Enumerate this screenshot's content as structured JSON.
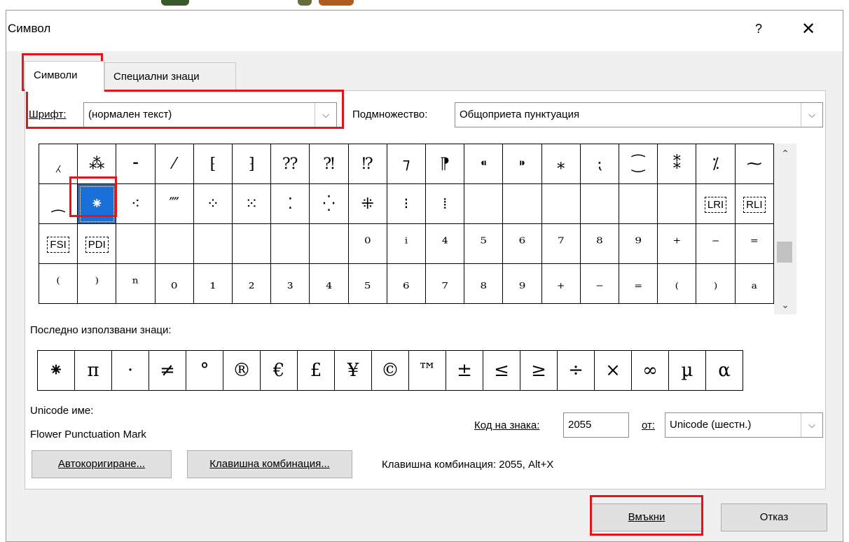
{
  "dialog": {
    "title": "Символ",
    "help_glyph": "?",
    "close_glyph": "✕"
  },
  "tabs": [
    {
      "label": "Символи"
    },
    {
      "label": "Специални знаци"
    }
  ],
  "font": {
    "label": "Шрифт:",
    "value": "(нормален текст)"
  },
  "subset": {
    "label": "Подмножество:",
    "value": "Общоприета пунктуация"
  },
  "symbol_grid": {
    "rows": [
      [
        "⁁",
        "⁂",
        "⁃",
        "⁄",
        "⁅",
        "⁆",
        "⁇",
        "⁈",
        "⁉",
        "⁊",
        "⁋",
        "⁌",
        "⁍",
        "⁎",
        "⁏",
        "⁐",
        "⁑",
        "⁒",
        "⁓"
      ],
      [
        "⁔",
        "⁕",
        "⁖",
        "⁗",
        "⁘",
        "⁙",
        "⁚",
        "⁛",
        "⁜",
        "⁝",
        "⁞",
        "",
        "",
        "",
        "",
        "",
        "",
        "LRI",
        "RLI"
      ],
      [
        "FSI",
        "PDI",
        "",
        "",
        "",
        "",
        "",
        "",
        "⁰",
        "ⁱ",
        "⁴",
        "⁵",
        "⁶",
        "⁷",
        "⁸",
        "⁹",
        "⁺",
        "⁻",
        "⁼"
      ],
      [
        "⁽",
        "⁾",
        "ⁿ",
        "₀",
        "₁",
        "₂",
        "₃",
        "₄",
        "₅",
        "₆",
        "₇",
        "₈",
        "₉",
        "₊",
        "₋",
        "₌",
        "₍",
        "₎",
        "ₐ"
      ]
    ],
    "selected": "⁕"
  },
  "scroll": {
    "up": "⌃",
    "down": "⌄"
  },
  "recent": {
    "label": "Последно използвани знаци:",
    "symbols": [
      "⁕",
      "π",
      "·",
      "≠",
      "°",
      "®",
      "€",
      "£",
      "¥",
      "©",
      "™",
      "±",
      "≤",
      "≥",
      "÷",
      "×",
      "∞",
      "µ",
      "α"
    ]
  },
  "unicode_name": {
    "label": "Unicode име:",
    "value": "Flower Punctuation Mark"
  },
  "char_code": {
    "label": "Код на знака:",
    "value": "2055"
  },
  "from": {
    "label": "от:",
    "value": "Unicode (шестн.)"
  },
  "buttons": {
    "autocorrect": "Автокоригиране...",
    "shortcut_key": "Клавишна комбинация...",
    "insert": "Вмъкни",
    "cancel": "Отказ"
  },
  "shortcut_text": "Клавишна комбинация: 2055, Alt+X",
  "colors": {
    "selection": "#1a6fd9",
    "highlight": "#e3141b"
  }
}
